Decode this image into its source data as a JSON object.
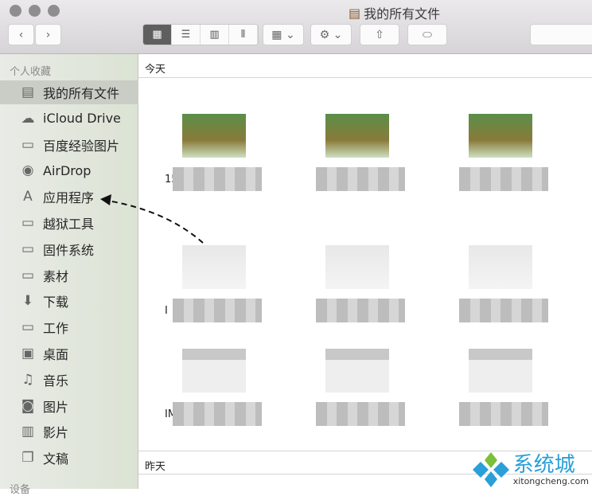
{
  "window": {
    "title": "我的所有文件"
  },
  "toolbar": {
    "back": "‹",
    "forward": "›",
    "views": [
      "icon",
      "list",
      "column",
      "coverflow"
    ],
    "active_view": "icon"
  },
  "sidebar": {
    "heading": "个人收藏",
    "devices_heading": "设备",
    "items": [
      {
        "label": "我的所有文件",
        "icon": "all-files-icon",
        "glyph": "▤",
        "selected": true
      },
      {
        "label": "iCloud Drive",
        "icon": "cloud-icon",
        "glyph": "☁"
      },
      {
        "label": "百度经验图片",
        "icon": "folder-icon",
        "glyph": "▭"
      },
      {
        "label": "AirDrop",
        "icon": "airdrop-icon",
        "glyph": "◉"
      },
      {
        "label": "应用程序",
        "icon": "applications-icon",
        "glyph": "A"
      },
      {
        "label": "越狱工具",
        "icon": "folder-icon",
        "glyph": "▭"
      },
      {
        "label": "固件系统",
        "icon": "folder-icon",
        "glyph": "▭"
      },
      {
        "label": "素材",
        "icon": "folder-icon",
        "glyph": "▭"
      },
      {
        "label": "下载",
        "icon": "download-icon",
        "glyph": "⬇"
      },
      {
        "label": "工作",
        "icon": "folder-icon",
        "glyph": "▭"
      },
      {
        "label": "桌面",
        "icon": "desktop-icon",
        "glyph": "▣"
      },
      {
        "label": "音乐",
        "icon": "music-icon",
        "glyph": "♫"
      },
      {
        "label": "图片",
        "icon": "camera-icon",
        "glyph": "◙"
      },
      {
        "label": "影片",
        "icon": "film-icon",
        "glyph": "▥"
      },
      {
        "label": "文稿",
        "icon": "document-icon",
        "glyph": "❐"
      }
    ]
  },
  "main": {
    "sections": [
      {
        "label": "今天"
      },
      {
        "label": "昨天"
      }
    ],
    "files": [
      {
        "prefix": "15_",
        "thumb": "green"
      },
      {
        "prefix": "",
        "thumb": "green"
      },
      {
        "prefix": "",
        "thumb": "green"
      },
      {
        "prefix": "I",
        "thumb": "light"
      },
      {
        "prefix": "",
        "thumb": "light"
      },
      {
        "prefix": "",
        "thumb": "light"
      },
      {
        "prefix": "IM",
        "thumb": "gray"
      },
      {
        "prefix": "",
        "thumb": "gray"
      },
      {
        "prefix": "",
        "thumb": "gray"
      }
    ]
  },
  "watermark": {
    "name": "系统城",
    "url": "xitongcheng.com"
  }
}
